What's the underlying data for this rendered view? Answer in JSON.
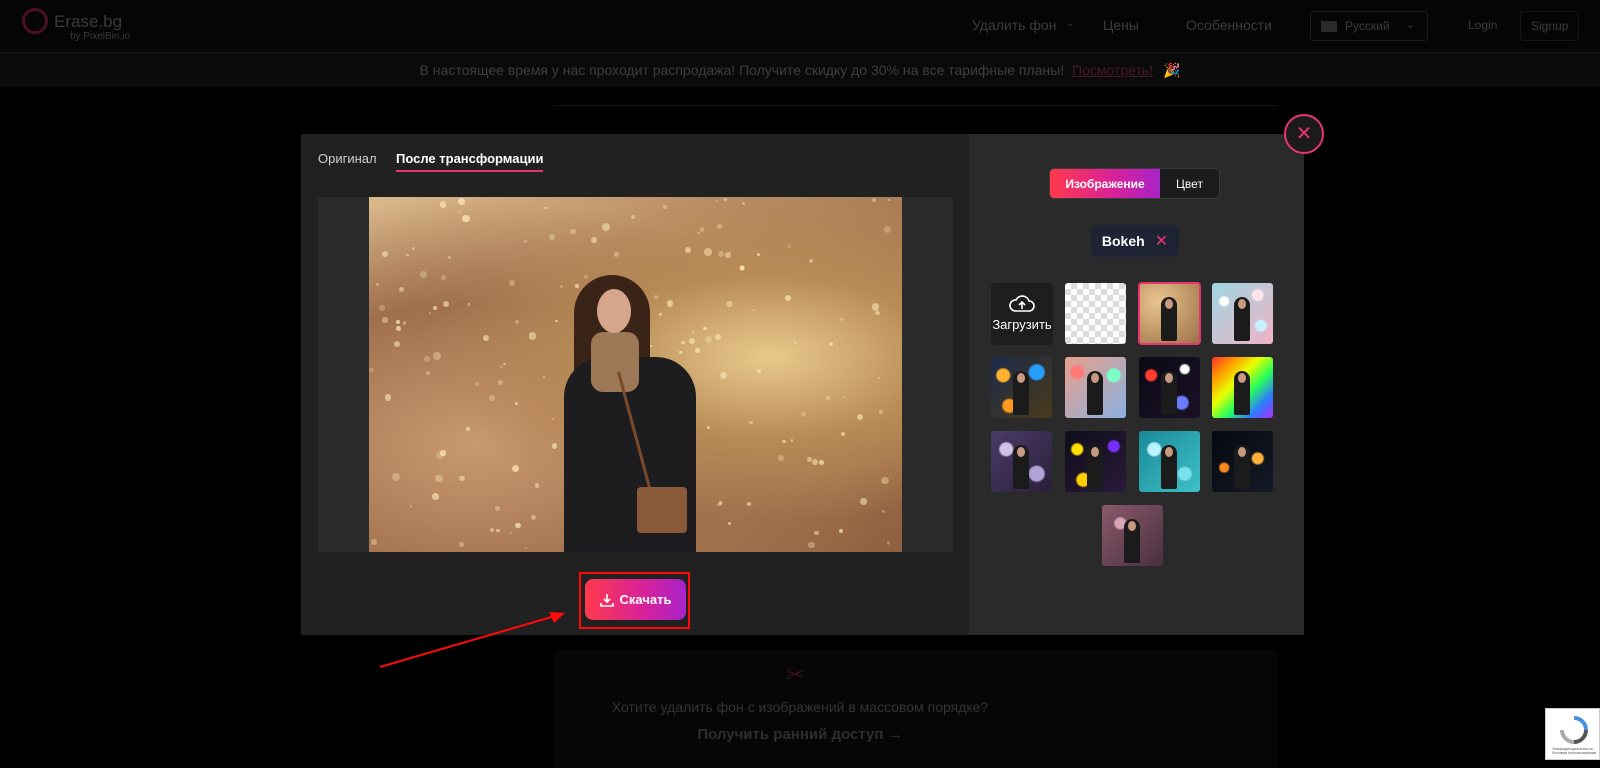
{
  "header": {
    "logo_name": "Erase.bg",
    "logo_sub": "by PixelBin.io",
    "nav": [
      "Удалить фон",
      "Цены",
      "Особенности"
    ],
    "language": "Русский",
    "login": "Login",
    "signup": "Signup"
  },
  "promo": {
    "text": "В настоящее время у нас проходит распродажа! Получите скидку до 30% на все тарифные планы!",
    "link": "Посмотреть!",
    "emoji": "🎉"
  },
  "bulk": {
    "question": "Хотите удалить фон с изображений в массовом порядке?",
    "cta": "Получить ранний доступ →"
  },
  "modal": {
    "tabs": [
      {
        "label": "Оригинал",
        "active": false
      },
      {
        "label": "После трансформации",
        "active": true
      }
    ],
    "download_label": "Скачать",
    "close_glyph": "✕",
    "mode": {
      "image_label": "Изображение",
      "color_label": "Цвет"
    },
    "selected_chip": {
      "label": "Bokeh",
      "remove_glyph": "✕"
    },
    "upload_label": "Загрузить",
    "thumbnails": [
      {
        "name": "transparent",
        "selected": false
      },
      {
        "name": "bokeh-gold",
        "selected": true
      },
      {
        "name": "bokeh-pastel",
        "selected": false
      },
      {
        "name": "bokeh-orange-blue",
        "selected": false
      },
      {
        "name": "bokeh-multicolor",
        "selected": false
      },
      {
        "name": "bokeh-dark-lights",
        "selected": false
      },
      {
        "name": "bokeh-rainbow",
        "selected": false
      },
      {
        "name": "bokeh-purple",
        "selected": false
      },
      {
        "name": "bokeh-yellow-night",
        "selected": false
      },
      {
        "name": "bokeh-teal",
        "selected": false
      },
      {
        "name": "bokeh-night-orange",
        "selected": false
      },
      {
        "name": "bokeh-mauve",
        "selected": false
      }
    ]
  },
  "recaptcha": {
    "text": "Конфиденциальность - Условия использования"
  },
  "colors": {
    "accent": "#e8356d",
    "gradient_start": "#ff3a4c",
    "gradient_end": "#a823c9",
    "highlight": "#ff0a0a"
  }
}
